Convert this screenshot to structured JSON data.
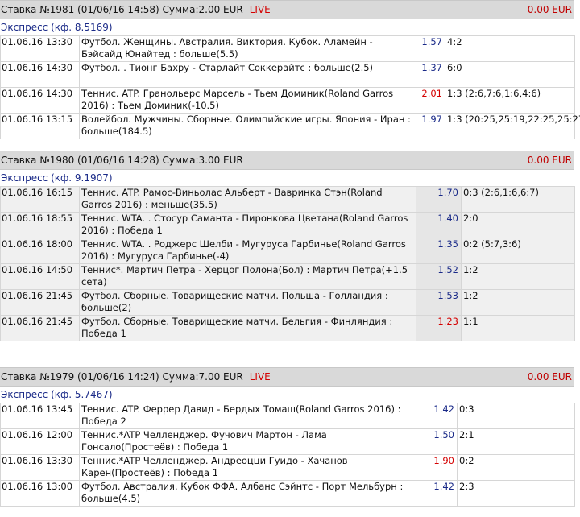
{
  "bets": [
    {
      "header": "Ставка №1981  (01/06/16 14:58) Сумма:2.00 EUR",
      "live": "LIVE",
      "result": "0.00 EUR",
      "type": "Экспресс (кф. 8.5169)",
      "rows": [
        {
          "date": "01.06.16 13:30",
          "event": "Футбол. Женщины. Австралия. Виктория. Кубок. Аламейн - Бэйсайд Юнайтед : больше(5.5)",
          "odds": "1.57",
          "odds_color": "blue",
          "score": "4:2"
        },
        {
          "date": "01.06.16 14:30",
          "event": "Футбол. . Тионг Бахру - Старлайт Соккерайтс : больше(2.5)",
          "odds": "1.37",
          "odds_color": "blue",
          "score": "6:0"
        },
        {
          "date": "01.06.16 14:30",
          "event": "Теннис. ATP. Гранольерс Марсель - Тьем Доминик(Roland Garros 2016) : Тьем Доминик(-10.5)",
          "odds": "2.01",
          "odds_color": "red",
          "score": "1:3 (2:6,7:6,1:6,4:6)"
        },
        {
          "date": "01.06.16 13:15",
          "event": "Волейбол. Мужчины. Сборные. Олимпийские игры. Япония - Иран : больше(184.5)",
          "odds": "1.97",
          "odds_color": "blue",
          "score": "1:3 (20:25,25:19,22:25,25:27)"
        }
      ]
    },
    {
      "header": "Ставка №1980  (01/06/16 14:28) Сумма:3.00 EUR",
      "live": "",
      "result": "0.00 EUR",
      "type": "Экспресс (кф. 9.1907)",
      "rows": [
        {
          "date": "01.06.16 16:15",
          "event": "Теннис. ATP. Рамос-Виньолас Альберт - Вавринка Стэн(Roland Garros 2016) : меньше(35.5)",
          "odds": "1.70",
          "odds_color": "blue",
          "score": "0:3 (2:6,1:6,6:7)"
        },
        {
          "date": "01.06.16 18:55",
          "event": "Теннис. WTA. . Стосур Саманта - Пиронкова Цветана(Roland Garros 2016) : Победа 1",
          "odds": "1.40",
          "odds_color": "blue",
          "score": "2:0"
        },
        {
          "date": "01.06.16 18:00",
          "event": "Теннис. WTA. . Роджерс Шелби - Мугуруса Гарбинье(Roland Garros 2016) : Мугуруса Гарбинье(-4)",
          "odds": "1.35",
          "odds_color": "blue",
          "score": "0:2 (5:7,3:6)"
        },
        {
          "date": "01.06.16 14:50",
          "event": "Теннис*. Мартич Петра - Херцог Полона(Бол) : Мартич Петра(+1.5 сета)",
          "odds": "1.52",
          "odds_color": "blue",
          "score": "1:2"
        },
        {
          "date": "01.06.16 21:45",
          "event": "Футбол. Сборные. Товарищеские матчи. Польша - Голландия : больше(2)",
          "odds": "1.53",
          "odds_color": "blue",
          "score": "1:2"
        },
        {
          "date": "01.06.16 21:45",
          "event": "Футбол. Сборные. Товарищеские матчи. Бельгия - Финляндия : Победа 1",
          "odds": "1.23",
          "odds_color": "red",
          "score": "1:1"
        }
      ]
    },
    {
      "header": "Ставка №1979  (01/06/16 14:24) Сумма:7.00 EUR",
      "live": "LIVE",
      "result": "0.00 EUR",
      "type": "Экспресс (кф. 5.7467)",
      "rows": [
        {
          "date": "01.06.16 13:45",
          "event": "Теннис. ATP. Феррер Давид - Бердых Томаш(Roland Garros 2016) : Победа 2",
          "odds": "1.42",
          "odds_color": "blue",
          "score": "0:3"
        },
        {
          "date": "01.06.16 12:00",
          "event": "Теннис.*ATP Челленджер. Фучович Мартон - Лама Гонсало(Простеёв) : Победа 1",
          "odds": "1.50",
          "odds_color": "blue",
          "score": "2:1"
        },
        {
          "date": "01.06.16 13:30",
          "event": "Теннис.*ATP Челленджер. Андреоцци Гуидо - Хачанов Карен(Простеёв) : Победа 1",
          "odds": "1.90",
          "odds_color": "red",
          "score": "0:2"
        },
        {
          "date": "01.06.16 13:00",
          "event": "Футбол. Австралия. Кубок ФФА. Албанс Сэйнтс - Порт Мельбурн : больше(4.5)",
          "odds": "1.42",
          "odds_color": "blue",
          "score": "2:3"
        }
      ]
    }
  ]
}
